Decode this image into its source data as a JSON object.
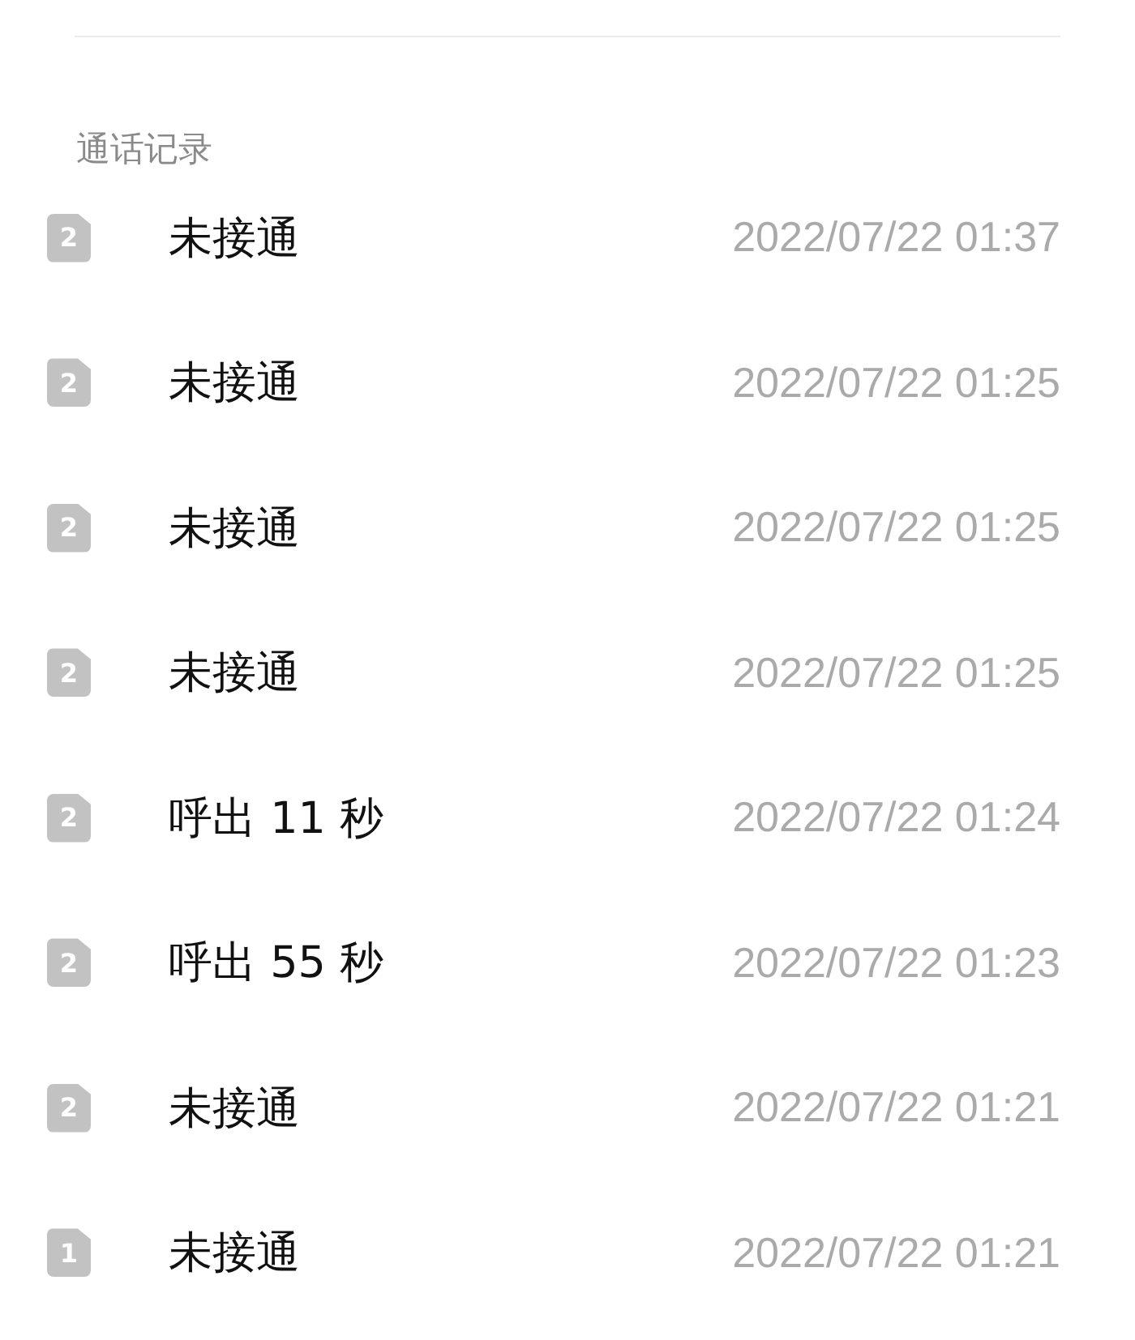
{
  "section": {
    "title": "通话记录"
  },
  "calls": [
    {
      "sim": "2",
      "status": "未接通",
      "time": "2022/07/22 01:37"
    },
    {
      "sim": "2",
      "status": "未接通",
      "time": "2022/07/22 01:25"
    },
    {
      "sim": "2",
      "status": "未接通",
      "time": "2022/07/22 01:25"
    },
    {
      "sim": "2",
      "status": "未接通",
      "time": "2022/07/22 01:25"
    },
    {
      "sim": "2",
      "status": "呼出 11 秒",
      "time": "2022/07/22 01:24"
    },
    {
      "sim": "2",
      "status": "呼出 55 秒",
      "time": "2022/07/22 01:23"
    },
    {
      "sim": "2",
      "status": "未接通",
      "time": "2022/07/22 01:21"
    },
    {
      "sim": "1",
      "status": "未接通",
      "time": "2022/07/22 01:21"
    }
  ]
}
